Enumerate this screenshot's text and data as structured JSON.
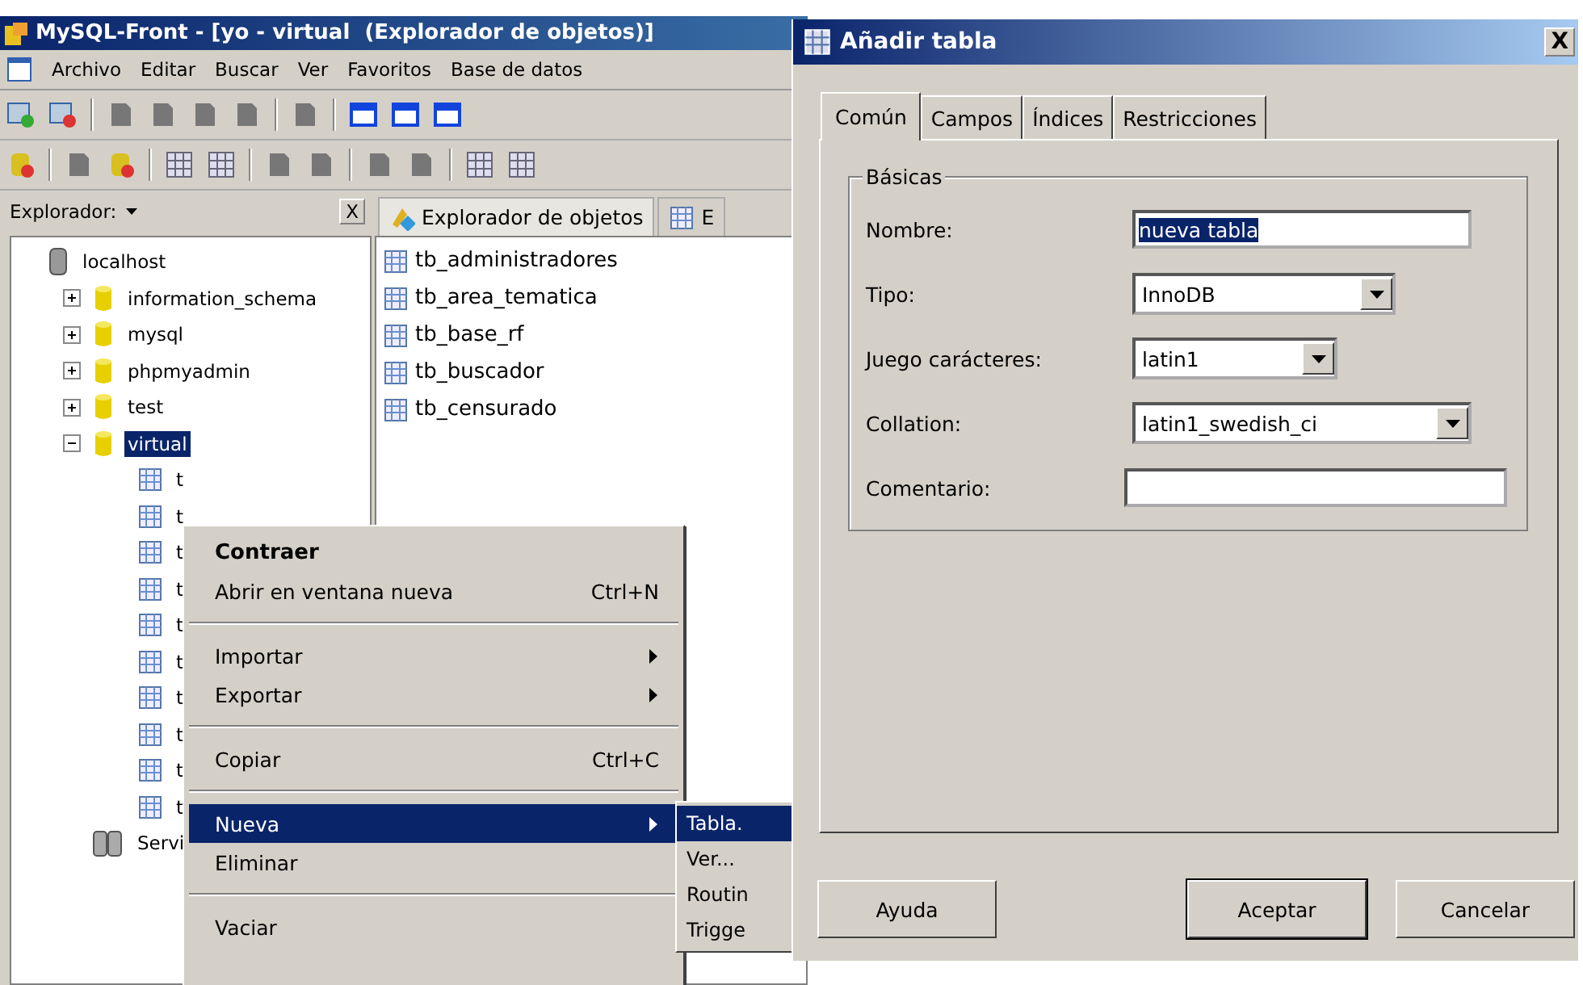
{
  "main_window": {
    "title": "MySQL-Front - [yo - virtual  (Explorador de objetos)]"
  },
  "menu_bar": [
    "Archivo",
    "Editar",
    "Buscar",
    "Ver",
    "Favoritos",
    "Base de datos"
  ],
  "explorer": {
    "label": "Explorador:",
    "close": "X"
  },
  "tree": [
    {
      "label": "localhost",
      "kind": "server",
      "selected": false,
      "children": [
        {
          "label": "information_schema",
          "kind": "database",
          "expanded": false,
          "selected": false
        },
        {
          "label": "mysql",
          "kind": "database",
          "expanded": false,
          "selected": false
        },
        {
          "label": "phpmyadmin",
          "kind": "database",
          "expanded": false,
          "selected": false
        },
        {
          "label": "test",
          "kind": "database",
          "expanded": false,
          "selected": false
        },
        {
          "label": "virtual",
          "kind": "database",
          "expanded": true,
          "selected": true,
          "children": [
            {
              "label": "t",
              "kind": "table",
              "selected": false
            },
            {
              "label": "t",
              "kind": "table",
              "selected": false
            },
            {
              "label": "t",
              "kind": "table",
              "selected": false
            },
            {
              "label": "t",
              "kind": "table",
              "selected": false
            },
            {
              "label": "t",
              "kind": "table",
              "selected": false
            },
            {
              "label": "t",
              "kind": "table",
              "selected": false
            },
            {
              "label": "t",
              "kind": "table",
              "selected": false
            },
            {
              "label": "t",
              "kind": "table",
              "selected": false
            },
            {
              "label": "t",
              "kind": "table",
              "selected": false
            },
            {
              "label": "t",
              "kind": "table",
              "selected": false
            }
          ]
        },
        {
          "label": "Servi",
          "kind": "servers",
          "selected": false
        }
      ]
    }
  ],
  "object_tabs": [
    {
      "label": "Explorador de objetos",
      "kind": "explorer",
      "selected": true
    },
    {
      "label": "E",
      "kind": "table",
      "selected": false
    }
  ],
  "objects": [
    "tb_administradores",
    "tb_area_tematica",
    "tb_base_rf",
    "tb_buscador",
    "tb_censurado"
  ],
  "context_menu": [
    {
      "kind": "item",
      "label": "Contraer",
      "default": true,
      "selected": false
    },
    {
      "kind": "item",
      "label": "Abrir en ventana nueva",
      "shortcut": "Ctrl+N",
      "selected": false
    },
    {
      "kind": "separator"
    },
    {
      "kind": "item",
      "label": "Importar",
      "submenu": true,
      "selected": false
    },
    {
      "kind": "item",
      "label": "Exportar",
      "submenu": true,
      "selected": false
    },
    {
      "kind": "separator"
    },
    {
      "kind": "item",
      "label": "Copiar",
      "shortcut": "Ctrl+C",
      "selected": false
    },
    {
      "kind": "separator"
    },
    {
      "kind": "item",
      "label": "Nueva",
      "submenu": true,
      "selected": true
    },
    {
      "kind": "item",
      "label": "Eliminar",
      "selected": false
    },
    {
      "kind": "separator"
    },
    {
      "kind": "item",
      "label": "Vaciar",
      "selected": false
    }
  ],
  "submenu": [
    {
      "label": "Tabla.",
      "selected": true
    },
    {
      "label": "Ver...",
      "selected": false
    },
    {
      "label": "Routin",
      "selected": false
    },
    {
      "label": "Trigge",
      "selected": false
    }
  ],
  "dialog": {
    "title": "Añadir tabla",
    "close": "X",
    "tabs": [
      {
        "label": "Común",
        "selected": true
      },
      {
        "label": "Campos",
        "selected": false
      },
      {
        "label": "Índices",
        "selected": false
      },
      {
        "label": "Restricciones",
        "selected": false
      }
    ],
    "group": "Básicas",
    "fields": [
      {
        "label": "Nombre:",
        "kind": "text",
        "value": "nueva tabla",
        "highlighted": true
      },
      {
        "label": "Tipo:",
        "kind": "select",
        "value": "InnoDB"
      },
      {
        "label": "Juego carácteres:",
        "kind": "select",
        "value": "latin1"
      },
      {
        "label": "Collation:",
        "kind": "select",
        "value": "latin1_swedish_ci"
      },
      {
        "label": "Comentario:",
        "kind": "text"
      }
    ],
    "buttons": [
      {
        "label": "Ayuda",
        "default": false
      },
      {
        "label": "Aceptar",
        "default": true
      },
      {
        "label": "Cancelar",
        "default": false
      }
    ]
  }
}
